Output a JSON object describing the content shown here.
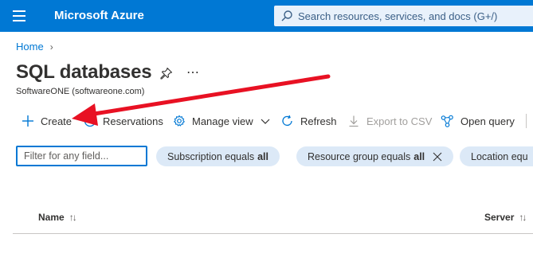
{
  "topbar": {
    "brand": "Microsoft Azure",
    "search_placeholder": "Search resources, services, and docs (G+/)"
  },
  "breadcrumb": {
    "home": "Home"
  },
  "page": {
    "title": "SQL databases",
    "subtitle": "SoftwareONE (softwareone.com)"
  },
  "commands": {
    "create": "Create",
    "reservations": "Reservations",
    "manage_view": "Manage view",
    "refresh": "Refresh",
    "export_csv": "Export to CSV",
    "open_query": "Open query"
  },
  "filters": {
    "placeholder": "Filter for any field...",
    "subscription_label": "Subscription equals",
    "subscription_value": "all",
    "resource_group_label": "Resource group equals",
    "resource_group_value": "all",
    "location_label": "Location equ"
  },
  "grid": {
    "columns": [
      "Name",
      "Server"
    ]
  },
  "colors": {
    "brand_bar": "#0078d4",
    "pill_bg": "#dce9f7",
    "annotation_arrow": "#e81123"
  }
}
